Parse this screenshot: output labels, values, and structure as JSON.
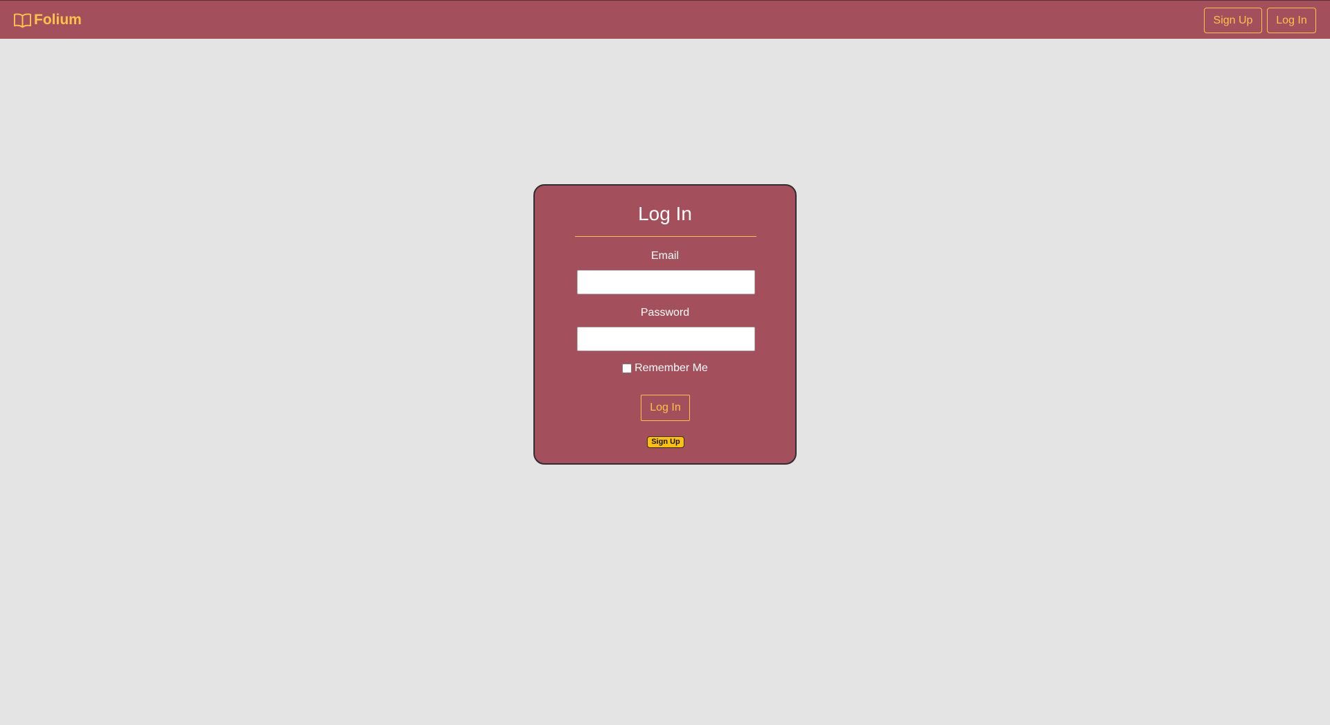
{
  "navbar": {
    "brand_label": "Folium",
    "signup_label": "Sign Up",
    "login_label": "Log In"
  },
  "login_card": {
    "title": "Log In",
    "email_label": "Email",
    "email_value": "",
    "password_label": "Password",
    "password_value": "",
    "remember_label": "Remember Me",
    "remember_checked": false,
    "submit_label": "Log In",
    "signup_link_label": "Sign Up"
  },
  "icons": {
    "brand": "open-book-icon"
  },
  "colors": {
    "navbar_bg": "#a34f5c",
    "accent": "#ffc34a",
    "page_bg": "#e4e4e4",
    "card_bg": "#a34f5c",
    "signup_badge_bg": "#ffc107"
  }
}
